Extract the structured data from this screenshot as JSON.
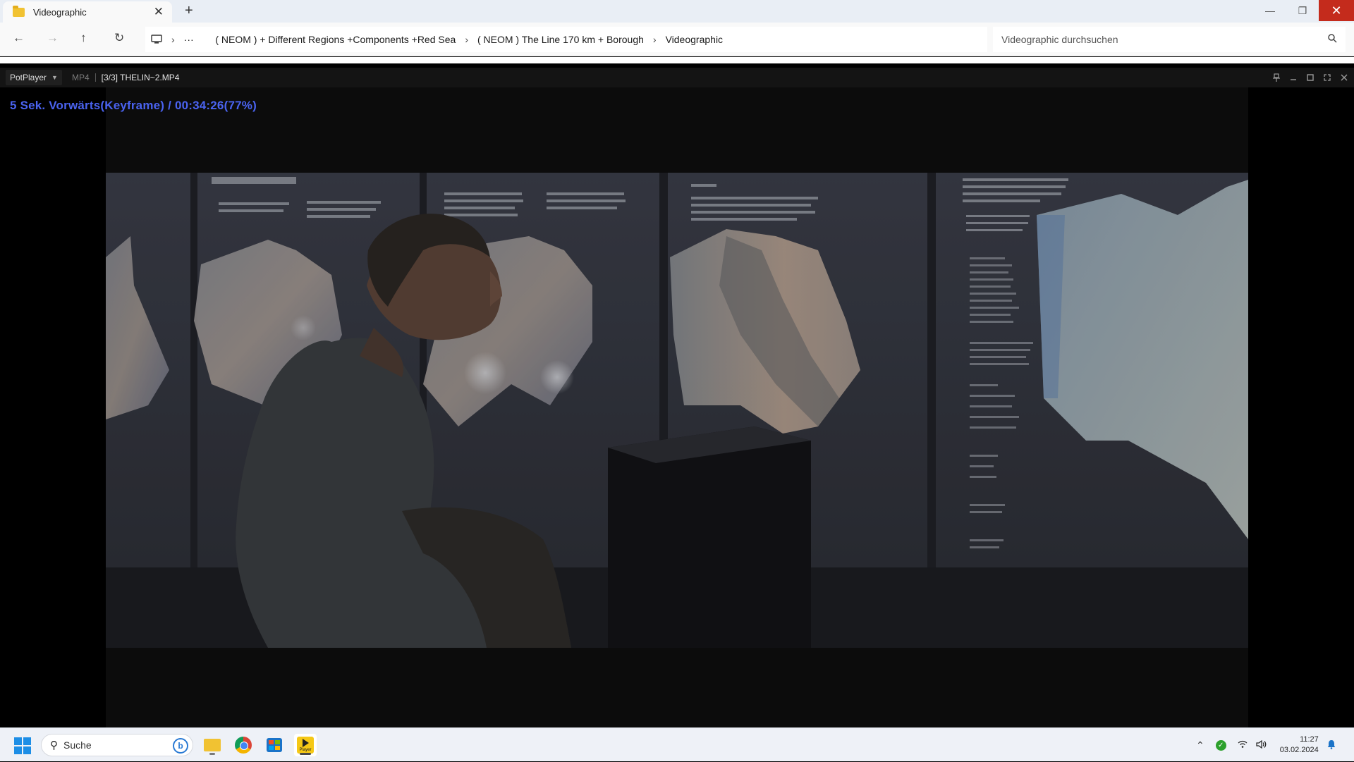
{
  "explorer": {
    "tab_title": "Videographic",
    "new_tab": "+",
    "tab_close": "✕",
    "window_controls": {
      "minimize": "—",
      "restore": "❐",
      "close": "✕"
    },
    "nav": {
      "back": "←",
      "forward": "→",
      "up": "↑",
      "refresh": "↻",
      "more": "···"
    },
    "breadcrumbs": [
      "( NEOM ) + Different Regions +Components +Red Sea",
      "( NEOM ) The Line 170 km + Borough",
      "Videographic"
    ],
    "search_placeholder": "Videographic durchsuchen"
  },
  "player": {
    "menu_label": "PotPlayer",
    "format": "MP4",
    "file_label": "[3/3] THELIN~2.MP4",
    "osd_text": "5  Sek. Vorwärts(Keyframe) / 00:34:26(77%)",
    "playback_position": 0.77
  },
  "taskbar": {
    "search_label": "Suche",
    "pinned_apps": [
      "file-explorer",
      "chrome",
      "microsoft-store",
      "potplayer"
    ],
    "potplayer_icon_text": "Player",
    "time": "11:27",
    "date": "03.02.2024"
  },
  "colors": {
    "osd": "#4a63f0",
    "close_button": "#c42b1c",
    "taskbar": "#eef1f7"
  }
}
